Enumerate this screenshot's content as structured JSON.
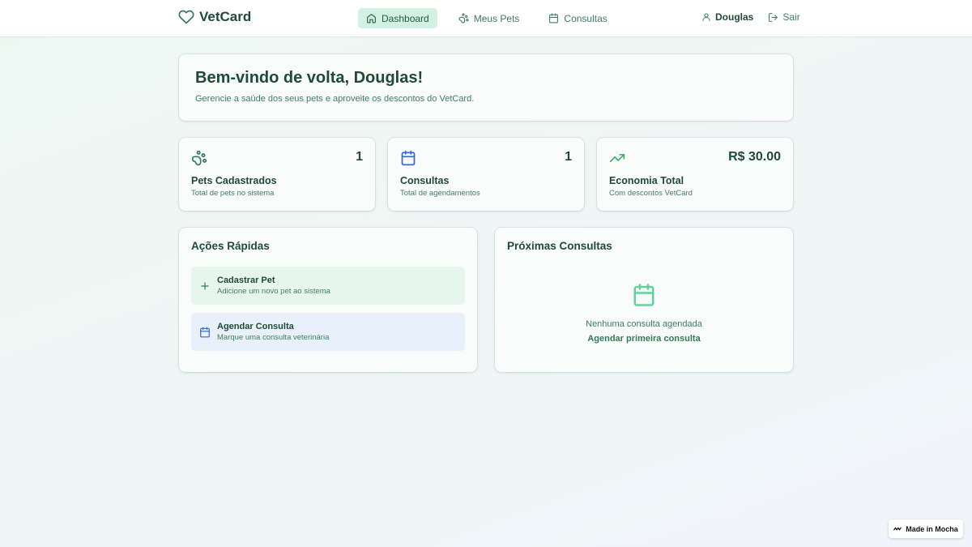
{
  "brand": {
    "name": "VetCard",
    "color": "#1f4a36"
  },
  "nav": [
    {
      "label": "Dashboard",
      "icon": "home-icon",
      "active": true
    },
    {
      "label": "Meus Pets",
      "icon": "paw-icon",
      "active": false
    },
    {
      "label": "Consultas",
      "icon": "calendar-icon",
      "active": false
    }
  ],
  "user": {
    "name": "Douglas",
    "logout_label": "Sair"
  },
  "welcome": {
    "title": "Bem-vindo de volta, Douglas!",
    "subtitle": "Gerencie a saúde dos seus pets e aproveite os descontos do VetCard."
  },
  "stats": [
    {
      "icon": "paw-icon",
      "value": "1",
      "title": "Pets Cadastrados",
      "subtitle": "Total de pets no sistema",
      "color": "#2f7a57"
    },
    {
      "icon": "calendar-icon",
      "value": "1",
      "title": "Consultas",
      "subtitle": "Total de agendamentos",
      "color": "#2f62d6"
    },
    {
      "icon": "trending-up-icon",
      "value": "R$ 30.00",
      "title": "Economia Total",
      "subtitle": "Com descontos VetCard",
      "color": "#3cae6d"
    }
  ],
  "quick_actions": {
    "title": "Ações Rápidas",
    "items": [
      {
        "icon": "plus-icon",
        "title": "Cadastrar Pet",
        "subtitle": "Adicione um novo pet ao sistema",
        "bg": "#e6f6ee"
      },
      {
        "icon": "calendar-icon",
        "title": "Agendar Consulta",
        "subtitle": "Marque uma consulta veterinária",
        "bg": "#e8f0fb"
      }
    ]
  },
  "upcoming": {
    "title": "Próximas Consultas",
    "empty_text": "Nenhuma consulta agendada",
    "cta_label": "Agendar primeira consulta"
  },
  "badge": {
    "label": "Made in Mocha"
  },
  "colors": {
    "accent": "#2f7a57",
    "active_nav_bg": "#d3f0e2",
    "text_dark": "#1f4a36",
    "text_muted": "#3f7d60"
  }
}
